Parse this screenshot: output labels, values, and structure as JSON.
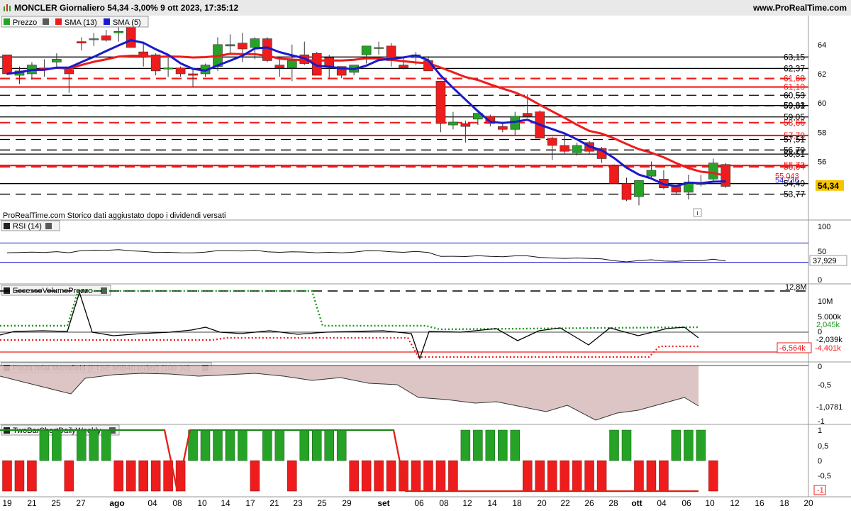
{
  "header": {
    "title": "MONCLER Giornaliero 54,34 -3,00% 9 ott 2023, 17:35:12",
    "site": "www.ProRealTime.com"
  },
  "colors": {
    "up": "#26a326",
    "down": "#ee1c1c",
    "sma13": "#ee1c1c",
    "sma5": "#1a1acc",
    "rsi_band": "#1a1acc",
    "mansfield_fill": "#d9bfbf"
  },
  "price_panel": {
    "legend": {
      "prezzo": "Prezzo",
      "sma13": "SMA (13)",
      "sma5": "SMA (5)"
    },
    "note": "ProRealTime.com  Storico dati aggiustato dopo i dividendi versati",
    "axis_ticks": [
      "64",
      "62",
      "60",
      "58",
      "56"
    ],
    "level_labels": [
      {
        "text": "63,15",
        "value": 63.15,
        "color": "#000000"
      },
      {
        "text": "62,37",
        "value": 62.37,
        "color": "#000000"
      },
      {
        "text": "61,68",
        "value": 61.68,
        "color": "#ee1c1c"
      },
      {
        "text": "61,10",
        "value": 61.1,
        "color": "#ee1c1c"
      },
      {
        "text": "60,53",
        "value": 60.53,
        "color": "#000000"
      },
      {
        "text": "59,83",
        "value": 59.83,
        "color": "#000000"
      },
      {
        "text": "59,81",
        "value": 59.81,
        "color": "#000000"
      },
      {
        "text": "59,05",
        "value": 59.05,
        "color": "#000000"
      },
      {
        "text": "58,66",
        "value": 58.66,
        "color": "#ee1c1c"
      },
      {
        "text": "57,78",
        "value": 57.78,
        "color": "#ee1c1c"
      },
      {
        "text": "57,51",
        "value": 57.51,
        "color": "#000000"
      },
      {
        "text": "56,79",
        "value": 56.79,
        "color": "#000000"
      },
      {
        "text": "56,51",
        "value": 56.51,
        "color": "#000000"
      },
      {
        "text": "55,73",
        "value": 55.73,
        "color": "#ee1c1c"
      },
      {
        "text": "55,64",
        "value": 55.64,
        "color": "#ee1c1c"
      },
      {
        "text": "54,49",
        "value": 54.49,
        "color": "#000000"
      },
      {
        "text": "53,77",
        "value": 53.77,
        "color": "#000000"
      }
    ],
    "value_tags": [
      {
        "text": "55.043",
        "value": 55.043,
        "color": "#ee1c1c"
      },
      {
        "text": "54.736",
        "value": 54.736,
        "color": "#1a1acc"
      }
    ],
    "price_tag": "54,34"
  },
  "rsi_panel": {
    "title": "RSI (14)",
    "ticks": [
      "100",
      "50",
      "0"
    ],
    "last": "37,929"
  },
  "evp_panel": {
    "title": "EccessoVolumePrezzo",
    "ticks": [
      "12,8M",
      "10M",
      "5.000k",
      "0"
    ],
    "labels": [
      "2,045k",
      "-2,039k",
      "-6,564k",
      "-4,401k"
    ]
  },
  "mansfield_panel": {
    "title": "Forza relat Mansfield (FTSE MIB40 Index) (100 10)",
    "ticks": [
      "0",
      "-0,5",
      "-1"
    ],
    "last": "-1,0781"
  },
  "twobar_panel": {
    "title": "TwoBarChartDailyWeekly",
    "ticks": [
      "1",
      "0,5",
      "0",
      "-0,5",
      "-1"
    ],
    "last": "-1"
  },
  "x_axis": [
    "19",
    "21",
    "25",
    "27",
    "ago",
    "04",
    "08",
    "10",
    "14",
    "17",
    "21",
    "23",
    "25",
    "29",
    "set",
    "06",
    "08",
    "12",
    "14",
    "18",
    "20",
    "22",
    "26",
    "28",
    "ott",
    "04",
    "06",
    "10",
    "12",
    "16",
    "18",
    "20"
  ],
  "chart_data": [
    {
      "type": "candlestick",
      "title": "MONCLER Giornaliero",
      "series_names": [
        "Prezzo",
        "SMA (13)",
        "SMA (5)"
      ],
      "ohlc": [
        [
          63.3,
          63.3,
          61.9,
          62.0
        ],
        [
          61.9,
          62.5,
          61.3,
          62.2
        ],
        [
          62.0,
          62.8,
          61.6,
          62.6
        ],
        [
          62.4,
          63.0,
          61.8,
          62.3
        ],
        [
          62.8,
          63.4,
          62.5,
          63.0
        ],
        [
          62.3,
          62.5,
          60.7,
          62.0
        ],
        [
          64.2,
          64.5,
          63.6,
          64.1
        ],
        [
          64.4,
          64.8,
          63.9,
          64.4
        ],
        [
          64.6,
          65.0,
          64.2,
          64.3
        ],
        [
          64.8,
          65.3,
          64.2,
          64.9
        ],
        [
          65.2,
          65.4,
          63.8,
          63.8
        ],
        [
          63.5,
          64.2,
          62.5,
          63.2
        ],
        [
          63.3,
          63.4,
          61.9,
          62.2
        ],
        [
          62.4,
          63.2,
          61.8,
          62.4
        ],
        [
          62.4,
          62.5,
          61.8,
          62.0
        ],
        [
          62.0,
          62.4,
          61.1,
          61.9
        ],
        [
          62.0,
          62.7,
          61.8,
          62.6
        ],
        [
          62.5,
          64.5,
          62.2,
          64.0
        ],
        [
          63.9,
          64.7,
          63.4,
          64.0
        ],
        [
          64.1,
          64.8,
          62.8,
          63.7
        ],
        [
          63.8,
          64.5,
          63.0,
          64.4
        ],
        [
          64.4,
          64.5,
          62.8,
          62.9
        ],
        [
          62.6,
          63.1,
          61.8,
          62.4
        ],
        [
          62.4,
          64.0,
          61.5,
          62.9
        ],
        [
          63.3,
          64.2,
          62.6,
          62.7
        ],
        [
          63.4,
          63.5,
          61.9,
          61.9
        ],
        [
          63.1,
          63.3,
          61.7,
          62.5
        ],
        [
          62.5,
          62.5,
          61.7,
          61.9
        ],
        [
          62.1,
          62.6,
          61.9,
          62.6
        ],
        [
          63.3,
          63.6,
          62.7,
          63.9
        ],
        [
          63.8,
          64.2,
          63.3,
          63.8
        ],
        [
          63.9,
          64.1,
          62.5,
          62.9
        ],
        [
          62.6,
          63.1,
          62.3,
          62.4
        ],
        [
          63.1,
          63.5,
          62.6,
          63.3
        ],
        [
          62.9,
          63.2,
          62.6,
          62.2
        ],
        [
          61.5,
          61.5,
          58.0,
          58.6
        ],
        [
          58.5,
          59.4,
          58.2,
          58.7
        ],
        [
          58.6,
          58.8,
          57.3,
          58.4
        ],
        [
          58.9,
          59.3,
          58.5,
          59.3
        ],
        [
          59.1,
          59.2,
          58.4,
          58.6
        ],
        [
          58.4,
          58.6,
          58.0,
          58.2
        ],
        [
          58.2,
          59.4,
          57.8,
          59.1
        ],
        [
          59.3,
          60.6,
          59.0,
          59.1
        ],
        [
          59.4,
          59.5,
          57.7,
          57.6
        ],
        [
          57.6,
          57.7,
          56.1,
          57.1
        ],
        [
          57.1,
          57.8,
          56.5,
          56.7
        ],
        [
          56.6,
          57.3,
          56.4,
          57.1
        ],
        [
          57.3,
          57.4,
          56.5,
          56.7
        ],
        [
          56.9,
          57.0,
          55.9,
          56.2
        ],
        [
          55.7,
          55.8,
          54.5,
          54.5
        ],
        [
          54.5,
          54.9,
          53.3,
          53.4
        ],
        [
          53.6,
          54.7,
          53.0,
          54.7
        ],
        [
          55.0,
          56.0,
          54.8,
          55.4
        ],
        [
          54.8,
          55.4,
          54.1,
          54.2
        ],
        [
          54.3,
          54.3,
          53.8,
          53.9
        ],
        [
          53.9,
          55.1,
          53.4,
          54.6
        ],
        [
          54.5,
          55.1,
          54.3,
          54.5
        ],
        [
          54.8,
          56.2,
          54.6,
          55.9
        ],
        [
          55.8,
          55.9,
          54.2,
          54.3
        ]
      ]
    },
    {
      "type": "line",
      "title": "RSI (14)",
      "last": 37.929,
      "ylim": [
        0,
        100
      ],
      "bands": [
        70,
        30
      ]
    },
    {
      "type": "line",
      "title": "EccessoVolumePrezzo",
      "labels": {
        "upper": 2.045,
        "lower": -4.401,
        "line": -2.039,
        "level": -6.564
      },
      "unit": "k"
    },
    {
      "type": "area",
      "title": "Forza relat Mansfield (FTSE MIB40 Index) (100 10)",
      "last": -1.0781,
      "ylim": [
        -1.1,
        0
      ]
    },
    {
      "type": "bar",
      "title": "TwoBarChartDailyWeekly",
      "ylim": [
        -1,
        1
      ],
      "last": -1,
      "daily_bars": [
        -1,
        -1,
        -1,
        1,
        1,
        -1,
        1,
        1,
        1,
        -1,
        -1,
        -1,
        -1,
        -1,
        -1,
        1,
        1,
        1,
        1,
        1,
        -1,
        1,
        1,
        -1,
        1,
        1,
        1,
        1,
        -1,
        -1,
        -1,
        -1,
        -1,
        -1,
        -1,
        -1,
        -1,
        1,
        1,
        1,
        1,
        1,
        -1,
        -1,
        -1,
        -1,
        -1,
        -1,
        -1,
        1,
        1,
        -1,
        -1,
        -1,
        1,
        1,
        1,
        -1
      ]
    }
  ]
}
